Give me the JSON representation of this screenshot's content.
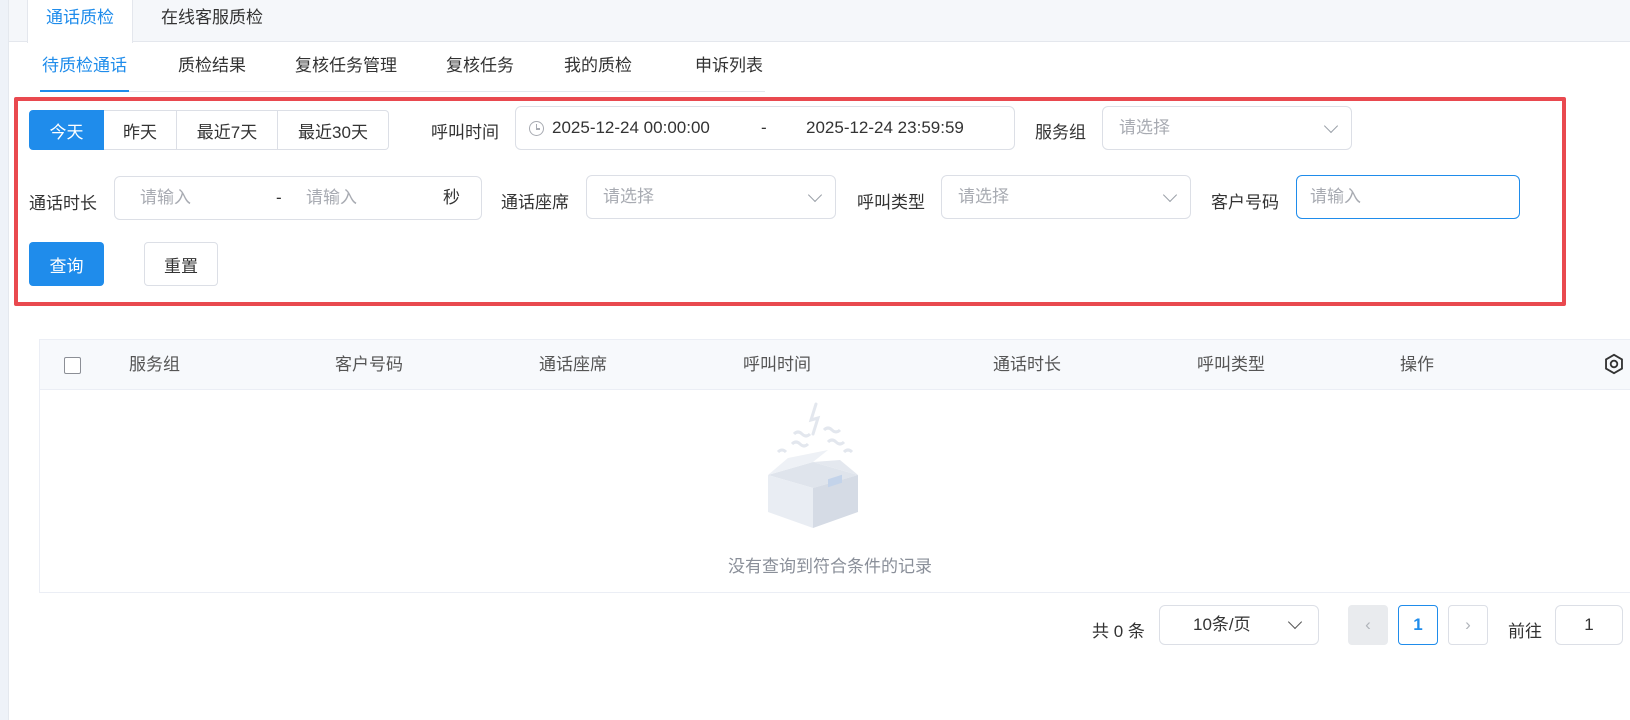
{
  "top_tabs": [
    "通话质检",
    "在线客服质检"
  ],
  "sub_tabs": [
    "待质检通话",
    "质检结果",
    "复核任务管理",
    "复核任务",
    "我的质检",
    "申诉列表"
  ],
  "quick_ranges": [
    "今天",
    "昨天",
    "最近7天",
    "最近30天"
  ],
  "filters": {
    "call_time_label": "呼叫时间",
    "call_time_start": "2025-12-24 00:00:00",
    "call_time_sep": "-",
    "call_time_end": "2025-12-24 23:59:59",
    "service_group_label": "服务组",
    "service_group_placeholder": "请选择",
    "duration_label": "通话时长",
    "duration_min_placeholder": "请输入",
    "duration_sep": "-",
    "duration_max_placeholder": "请输入",
    "duration_unit": "秒",
    "agent_label": "通话座席",
    "agent_placeholder": "请选择",
    "call_type_label": "呼叫类型",
    "call_type_placeholder": "请选择",
    "customer_number_label": "客户号码",
    "customer_number_placeholder": "请输入"
  },
  "actions": {
    "query": "查询",
    "reset": "重置"
  },
  "table": {
    "columns": [
      "服务组",
      "客户号码",
      "通话座席",
      "呼叫时间",
      "通话时长",
      "呼叫类型",
      "操作"
    ],
    "rows": [],
    "empty_text": "没有查询到符合条件的记录"
  },
  "pagination": {
    "total_text": "共 0 条",
    "page_size": "10条/页",
    "current_page": "1",
    "goto_label": "前往",
    "goto_value": "1"
  },
  "colors": {
    "accent": "#1f8ceb",
    "highlight": "#e9494f"
  },
  "icons": [
    "clock-icon",
    "chevron-down-icon",
    "settings-icon",
    "empty-box-icon",
    "chevron-left-icon",
    "chevron-right-icon"
  ]
}
